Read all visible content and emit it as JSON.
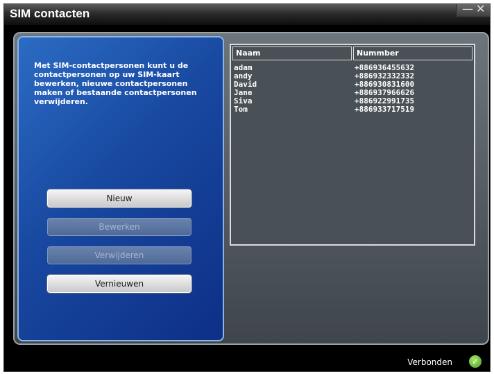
{
  "window": {
    "title": "SIM contacten",
    "minimize_glyph": "—",
    "close_glyph": "✕"
  },
  "left_panel": {
    "description": "Met SIM-contactpersonen kunt u de contactpersonen op uw SIM-kaart bewerken, nieuwe contactpersonen maken of bestaande contactpersonen verwijderen.",
    "buttons": {
      "new": "Nieuw",
      "edit": "Bewerken",
      "delete": "Verwijderen",
      "refresh": "Vernieuwen"
    }
  },
  "contacts_table": {
    "columns": [
      "Naam",
      "Nummber"
    ],
    "rows": [
      {
        "name": "adam",
        "number": "+886936455632"
      },
      {
        "name": "andy",
        "number": "+886932332332"
      },
      {
        "name": "David",
        "number": "+886930831600"
      },
      {
        "name": "Jane",
        "number": "+886937966626"
      },
      {
        "name": "Siva",
        "number": "+886922991735"
      },
      {
        "name": "Tom",
        "number": "+886933717519"
      }
    ]
  },
  "status": {
    "text": "Verbonden",
    "icon": "check-icon",
    "icon_glyph": "✓"
  }
}
